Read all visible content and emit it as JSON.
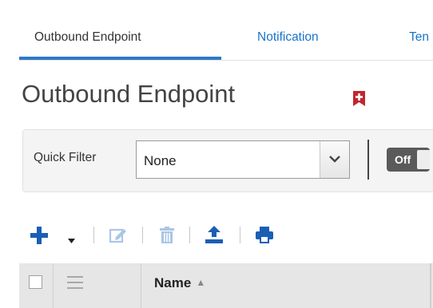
{
  "tabs": [
    {
      "label": "Outbound Endpoint",
      "active": true
    },
    {
      "label": "Notification",
      "active": false
    },
    {
      "label": "Ten",
      "active": false
    }
  ],
  "page": {
    "title": "Outbound Endpoint",
    "bookmark_icon": "bookmark-plus-icon",
    "bookmark_color": "#c0272d"
  },
  "filter": {
    "label": "Quick Filter",
    "selected": "None",
    "toggle_label": "Off"
  },
  "toolbar": {
    "icons": [
      "add-icon",
      "dropdown-caret-icon",
      "edit-icon",
      "delete-icon",
      "upload-icon",
      "print-icon"
    ],
    "accent": "#1a5fb4"
  },
  "grid": {
    "columns": [
      {
        "label": "Name",
        "sort": "ascending"
      }
    ]
  },
  "colors": {
    "link": "#1a73c9",
    "tab_underline": "#2f78c9",
    "toggle_bg": "#5a5a5a"
  }
}
